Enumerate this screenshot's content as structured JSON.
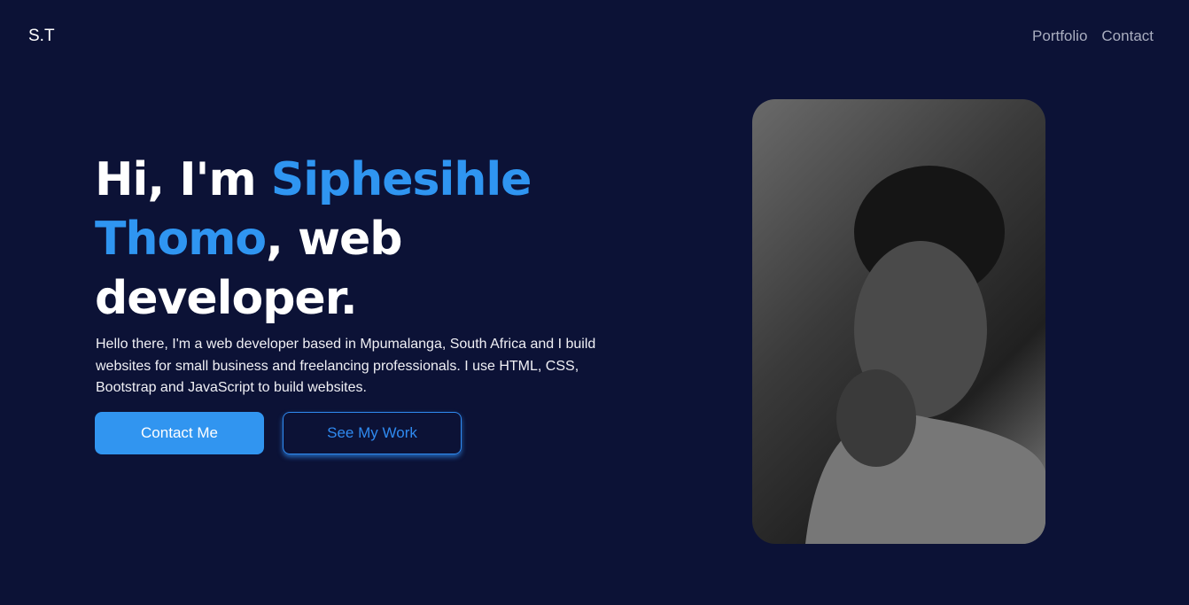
{
  "logo": "S.T",
  "nav": [
    "Portfolio",
    "Contact"
  ],
  "hero": {
    "t1": "Hi, I'm ",
    "name": "Siphesihle Thomo",
    "t2": ", web developer.",
    "description": "Hello there, I'm a web developer based in Mpumalanga, South Africa and I build websites for small business and freelancing professionals. I use HTML, CSS, Bootstrap and JavaScript to build websites.",
    "contact_button": "Contact Me",
    "work_button": "See My Work"
  }
}
